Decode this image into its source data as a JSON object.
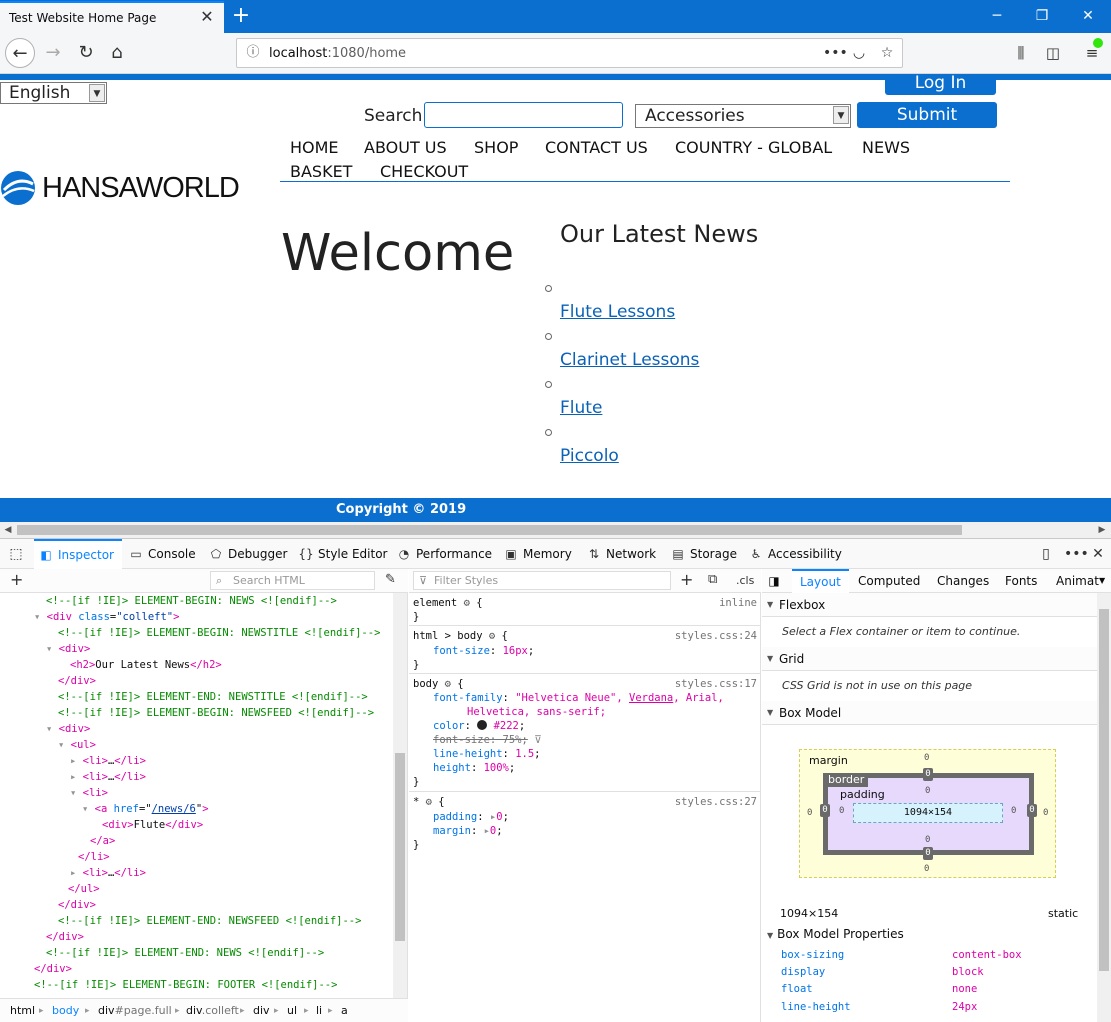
{
  "browser": {
    "tab_title": "Test Website Home Page",
    "url_host": "localhost",
    "url_path": ":1080/home"
  },
  "site": {
    "language": "English",
    "login_label": "Log In",
    "search_label": "Search",
    "category": "Accessories",
    "submit_label": "Submit",
    "logo_text": "HANSAWORLD",
    "nav": [
      "HOME",
      "ABOUT US",
      "SHOP",
      "CONTACT US",
      "COUNTRY - GLOBAL",
      "NEWS",
      "BASKET",
      "CHECKOUT"
    ],
    "welcome": "Welcome",
    "news_title": "Our Latest News",
    "news_items": [
      "Flute Lessons",
      "Clarinet Lessons",
      "Flute",
      "Piccolo"
    ],
    "copyright": "Copyright © 2019",
    "brand_color": "#0a6fce"
  },
  "devtools": {
    "tabs": [
      "Inspector",
      "Console",
      "Debugger",
      "Style Editor",
      "Performance",
      "Memory",
      "Network",
      "Storage",
      "Accessibility"
    ],
    "search_html_placeholder": "Search HTML",
    "filter_styles_placeholder": "Filter Styles",
    "cls_label": ".cls",
    "markup": {
      "l1": "<!--[if !IE]> ELEMENT-BEGIN: NEWS <![endif]-->",
      "l2_tag": "<div",
      "l2_attr": "class",
      "l2_val": "\"colleft\"",
      "l2_end": ">",
      "l3": "<!--[if !IE]> ELEMENT-BEGIN: NEWSTITLE <![endif]-->",
      "l4": "<div>",
      "l5_open": "<h2>",
      "l5_text": "Our Latest News",
      "l5_close": "</h2>",
      "l6": "</div>",
      "l7": "<!--[if !IE]> ELEMENT-END: NEWSTITLE <![endif]-->",
      "l8": "<!--[if !IE]> ELEMENT-BEGIN: NEWSFEED <![endif]-->",
      "l9": "<div>",
      "l10": "<ul>",
      "li_open": "<li>",
      "li_close": "</li>",
      "ellipsis": "…",
      "l14_tag": "<a",
      "l14_attr": "href",
      "l14_val": "/news/6",
      "l15_open": "<div>",
      "l15_text": "Flute",
      "l15_close": "</div>",
      "l16": "</a>",
      "l17": "</li>",
      "l19": "</ul>",
      "l20": "</div>",
      "l21": "<!--[if !IE]> ELEMENT-END: NEWSFEED <![endif]-->",
      "l22": "</div>",
      "l23": "<!--[if !IE]> ELEMENT-END: NEWS <![endif]-->",
      "l24": "</div>",
      "l25": "<!--[if !IE]> ELEMENT-BEGIN: FOOTER <![endif]-->"
    },
    "breadcrumbs": [
      "html",
      "body",
      "div",
      "#page.full",
      "div",
      ".colleft",
      "div",
      "ul",
      "li",
      "a"
    ],
    "rules": {
      "element_sel": "element",
      "element_src": "inline",
      "r1_sel": "html > body",
      "r1_src": "styles.css:24",
      "r1_p1": "font-size",
      "r1_v1": "16px",
      "r2_sel": "body",
      "r2_src": "styles.css:17",
      "r2_p1": "font-family",
      "r2_v1a": "\"Helvetica Neue\",",
      "r2_v1b": "Verdana",
      "r2_v1c": ", Arial,",
      "r2_v1d": "Helvetica, sans-serif;",
      "r2_p2": "color",
      "r2_v2": "#222",
      "r2_p3": "font-size: 75%;",
      "r2_p4": "line-height",
      "r2_v4": "1.5",
      "r2_p5": "height",
      "r2_v5": "100%",
      "r3_sel": "*",
      "r3_src": "styles.css:27",
      "r3_p1": "padding",
      "r3_v1": "0",
      "r3_p2": "margin",
      "r3_v2": "0"
    },
    "layout_tabs": [
      "Layout",
      "Computed",
      "Changes",
      "Fonts",
      "Animat"
    ],
    "flexbox_head": "Flexbox",
    "flexbox_note": "Select a Flex container or item to continue.",
    "grid_head": "Grid",
    "grid_note": "CSS Grid is not in use on this page",
    "boxmodel_head": "Box Model",
    "bm": {
      "margin_label": "margin",
      "border_label": "border",
      "padding_label": "padding",
      "content_size": "1094×154",
      "zero": "0"
    },
    "dimensions": "1094×154",
    "position": "static",
    "props_head": "Box Model Properties",
    "props": [
      {
        "k": "box-sizing",
        "v": "content-box"
      },
      {
        "k": "display",
        "v": "block"
      },
      {
        "k": "float",
        "v": "none"
      },
      {
        "k": "line-height",
        "v": "24px"
      }
    ]
  }
}
